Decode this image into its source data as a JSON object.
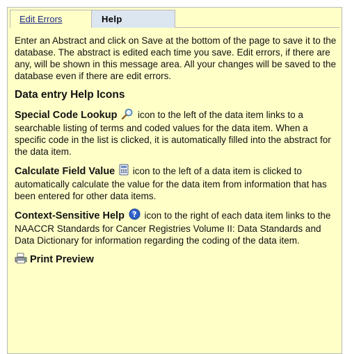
{
  "tabs": {
    "edit_errors": "Edit Errors",
    "help": "Help"
  },
  "intro": "Enter an Abstract and click on Save at the bottom of the page to save it to the database. The abstract is edited each time you save. Edit errors, if there are any, will be shown in this message area. All your changes will be saved to the database even if there are edit errors.",
  "heading": "Data entry Help Icons",
  "items": [
    {
      "term": "Special Code Lookup",
      "icon": "magnifier-icon",
      "text": " icon to the left of the data item links to a searchable listing of terms and coded values for the data item. When a specific code in the list is clicked, it is automatically filled into the abstract for the data item."
    },
    {
      "term": "Calculate Field Value",
      "icon": "calculator-icon",
      "text": " icon to the left of a data item is clicked to automatically calculate the value for the data item from information that has been entered for other data items."
    },
    {
      "term": "Context-Sensitive Help",
      "icon": "help-icon",
      "text": " icon to the right of each data item links to the NAACCR Standards for Cancer Registries Volume II: Data Standards and Data Dictionary for information regarding the coding of the data item."
    }
  ],
  "print_preview": "Print Preview",
  "colors": {
    "panel_bg": "#ffffc8",
    "help_tab_bg": "#dce6f0",
    "link": "#1f2d86",
    "border": "#b9b9b9"
  }
}
